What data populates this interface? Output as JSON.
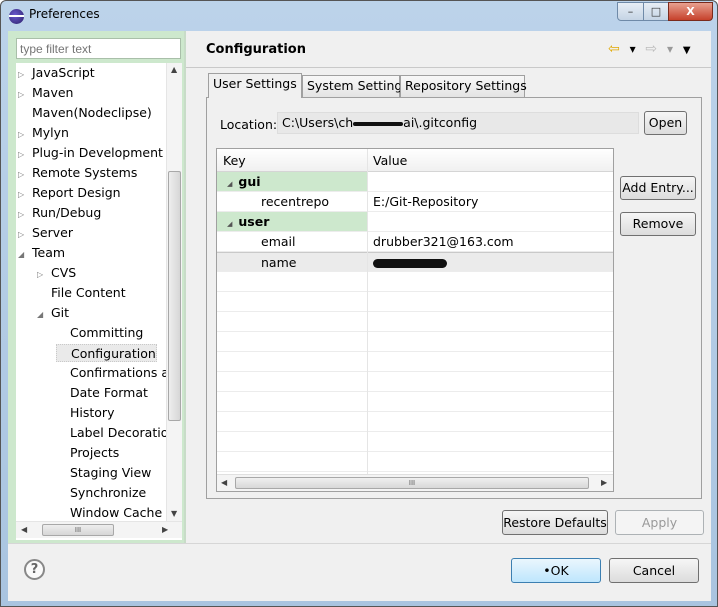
{
  "window": {
    "title": "Preferences",
    "minimize_glyph": "–",
    "maximize_glyph": "□",
    "close_glyph": "X"
  },
  "sidebar": {
    "filter_placeholder": "type filter text",
    "items": [
      {
        "label": "JavaScript",
        "twisty": "▷",
        "level": 0
      },
      {
        "label": "Maven",
        "twisty": "▷",
        "level": 0
      },
      {
        "label": "Maven(Nodeclipse)",
        "twisty": "",
        "level": 0
      },
      {
        "label": "Mylyn",
        "twisty": "▷",
        "level": 0
      },
      {
        "label": "Plug-in Development",
        "twisty": "▷",
        "level": 0
      },
      {
        "label": "Remote Systems",
        "twisty": "▷",
        "level": 0
      },
      {
        "label": "Report Design",
        "twisty": "▷",
        "level": 0
      },
      {
        "label": "Run/Debug",
        "twisty": "▷",
        "level": 0
      },
      {
        "label": "Server",
        "twisty": "▷",
        "level": 0
      },
      {
        "label": "Team",
        "twisty": "◢",
        "level": 0
      },
      {
        "label": "CVS",
        "twisty": "▷",
        "level": 1
      },
      {
        "label": "File Content",
        "twisty": "",
        "level": 1
      },
      {
        "label": "Git",
        "twisty": "◢",
        "level": 1
      },
      {
        "label": "Committing",
        "twisty": "",
        "level": 2
      },
      {
        "label": "Configuration",
        "twisty": "",
        "level": 2,
        "selected": true
      },
      {
        "label": "Confirmations a",
        "twisty": "",
        "level": 2
      },
      {
        "label": "Date Format",
        "twisty": "",
        "level": 2
      },
      {
        "label": "History",
        "twisty": "",
        "level": 2
      },
      {
        "label": "Label Decoratio",
        "twisty": "",
        "level": 2
      },
      {
        "label": "Projects",
        "twisty": "",
        "level": 2
      },
      {
        "label": "Staging View",
        "twisty": "",
        "level": 2
      },
      {
        "label": "Synchronize",
        "twisty": "",
        "level": 2
      },
      {
        "label": "Window Cache",
        "twisty": "",
        "level": 2
      }
    ]
  },
  "page": {
    "title": "Configuration",
    "nav": {
      "back_icon": "⇦",
      "back_menu_icon": "▾",
      "forward_icon": "⇨",
      "forward_menu_icon": "▾",
      "view_menu_icon": "▼"
    },
    "tabs": [
      {
        "label": "User Settings",
        "active": true
      },
      {
        "label": "System Settings",
        "active": false
      },
      {
        "label": "Repository Settings",
        "active": false
      }
    ],
    "location_label": "Location:",
    "location_value_prefix": "C:\\Users\\ch",
    "location_value_suffix": "ai\\.gitconfig",
    "open_button": "Open",
    "table": {
      "columns": [
        "Key",
        "Value"
      ],
      "rows": [
        {
          "key": "gui",
          "value": "",
          "type": "group"
        },
        {
          "key": "recentrepo",
          "value": "E:/Git-Repository",
          "type": "entry"
        },
        {
          "key": "user",
          "value": "",
          "type": "group"
        },
        {
          "key": "email",
          "value": "drubber321@163.com",
          "type": "entry"
        },
        {
          "key": "name",
          "value": "[redacted]",
          "type": "entry",
          "selected": true
        }
      ]
    },
    "add_entry_button": "Add Entry...",
    "remove_button": "Remove",
    "restore_defaults_button": "Restore Defaults",
    "apply_button": "Apply"
  },
  "footer": {
    "help_icon": "?",
    "ok_button": "•OK",
    "cancel_button": "Cancel"
  }
}
